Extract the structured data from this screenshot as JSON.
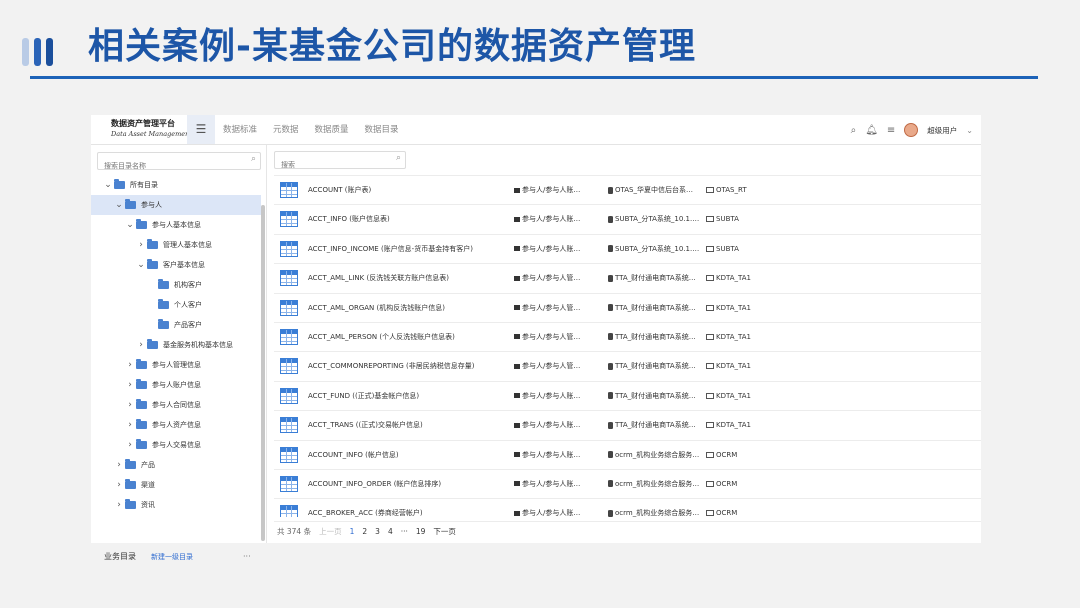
{
  "slide": {
    "title": "相关案例-某基金公司的数据资产管理"
  },
  "app": {
    "logo_cn": "数据资产管理平台",
    "logo_en": "Data Asset Management",
    "nav": [
      "数据标准",
      "元数据",
      "数据质量",
      "数据目录"
    ],
    "user": "超级用户"
  },
  "sidebar": {
    "search_placeholder": "搜索目录名称",
    "tree": [
      {
        "label": "所有目录",
        "level": 0,
        "expanded": true
      },
      {
        "label": "参与人",
        "level": 1,
        "expanded": true,
        "selected": true
      },
      {
        "label": "参与人基本信息",
        "level": 2,
        "expanded": true
      },
      {
        "label": "管理人基本信息",
        "level": 3,
        "expanded": false
      },
      {
        "label": "客户基本信息",
        "level": 3,
        "expanded": true
      },
      {
        "label": "机构客户",
        "level": 4,
        "leaf": true
      },
      {
        "label": "个人客户",
        "level": 4,
        "leaf": true
      },
      {
        "label": "产品客户",
        "level": 4,
        "leaf": true
      },
      {
        "label": "基金服务机构基本信息",
        "level": 3,
        "expanded": false
      },
      {
        "label": "参与人管理信息",
        "level": 2,
        "expanded": false
      },
      {
        "label": "参与人账户信息",
        "level": 2,
        "expanded": false
      },
      {
        "label": "参与人合同信息",
        "level": 2,
        "expanded": false
      },
      {
        "label": "参与人资产信息",
        "level": 2,
        "expanded": false
      },
      {
        "label": "参与人交易信息",
        "level": 2,
        "expanded": false
      },
      {
        "label": "产品",
        "level": 1,
        "expanded": false
      },
      {
        "label": "渠道",
        "level": 1,
        "expanded": false
      },
      {
        "label": "资讯",
        "level": 1,
        "expanded": false
      }
    ],
    "footer_title": "业务目录",
    "footer_link": "新建一级目录",
    "footer_more": "···"
  },
  "main": {
    "search_placeholder": "搜索",
    "rows": [
      {
        "name": "ACCOUNT (账户表)",
        "path": "参与人/参与人账…",
        "source": "OTAS_华夏中信后台系…",
        "system": "OTAS_RT"
      },
      {
        "name": "ACCT_INFO (账户信息表)",
        "path": "参与人/参与人账…",
        "source": "SUBTA_分TA系统_10.1.…",
        "system": "SUBTA"
      },
      {
        "name": "ACCT_INFO_INCOME (账户信息-货币基金持有客户)",
        "path": "参与人/参与人账…",
        "source": "SUBTA_分TA系统_10.1.…",
        "system": "SUBTA"
      },
      {
        "name": "ACCT_AML_LINK (反洗钱关联方账户信息表)",
        "path": "参与人/参与人管…",
        "source": "TTA_财付通电商TA系统…",
        "system": "KDTA_TA1"
      },
      {
        "name": "ACCT_AML_ORGAN (机构反洗钱账户信息)",
        "path": "参与人/参与人管…",
        "source": "TTA_财付通电商TA系统…",
        "system": "KDTA_TA1"
      },
      {
        "name": "ACCT_AML_PERSON (个人反洗钱账户信息表)",
        "path": "参与人/参与人管…",
        "source": "TTA_财付通电商TA系统…",
        "system": "KDTA_TA1"
      },
      {
        "name": "ACCT_COMMONREPORTING (非居民纳税信息存量)",
        "path": "参与人/参与人管…",
        "source": "TTA_财付通电商TA系统…",
        "system": "KDTA_TA1"
      },
      {
        "name": "ACCT_FUND ((正式)基金帐户信息)",
        "path": "参与人/参与人账…",
        "source": "TTA_财付通电商TA系统…",
        "system": "KDTA_TA1"
      },
      {
        "name": "ACCT_TRANS ((正式)交易帐户信息)",
        "path": "参与人/参与人账…",
        "source": "TTA_财付通电商TA系统…",
        "system": "KDTA_TA1"
      },
      {
        "name": "ACCOUNT_INFO (帐户信息)",
        "path": "参与人/参与人账…",
        "source": "ocrm_机构业务综合服务…",
        "system": "OCRM"
      },
      {
        "name": "ACCOUNT_INFO_ORDER (帐户信息排序)",
        "path": "参与人/参与人账…",
        "source": "ocrm_机构业务综合服务…",
        "system": "OCRM"
      },
      {
        "name": "ACC_BROKER_ACC (券商经营帐户)",
        "path": "参与人/参与人账…",
        "source": "ocrm_机构业务综合服务…",
        "system": "OCRM"
      }
    ],
    "pager": {
      "total": "共 374 条",
      "prev": "上一页",
      "pages": [
        "1",
        "2",
        "3",
        "4",
        "···",
        "19"
      ],
      "current": "1",
      "next": "下一页"
    }
  },
  "colors": {
    "title": "#1d56a7",
    "accent": "#2e6bd0",
    "selected_bg": "#dce6f7"
  }
}
